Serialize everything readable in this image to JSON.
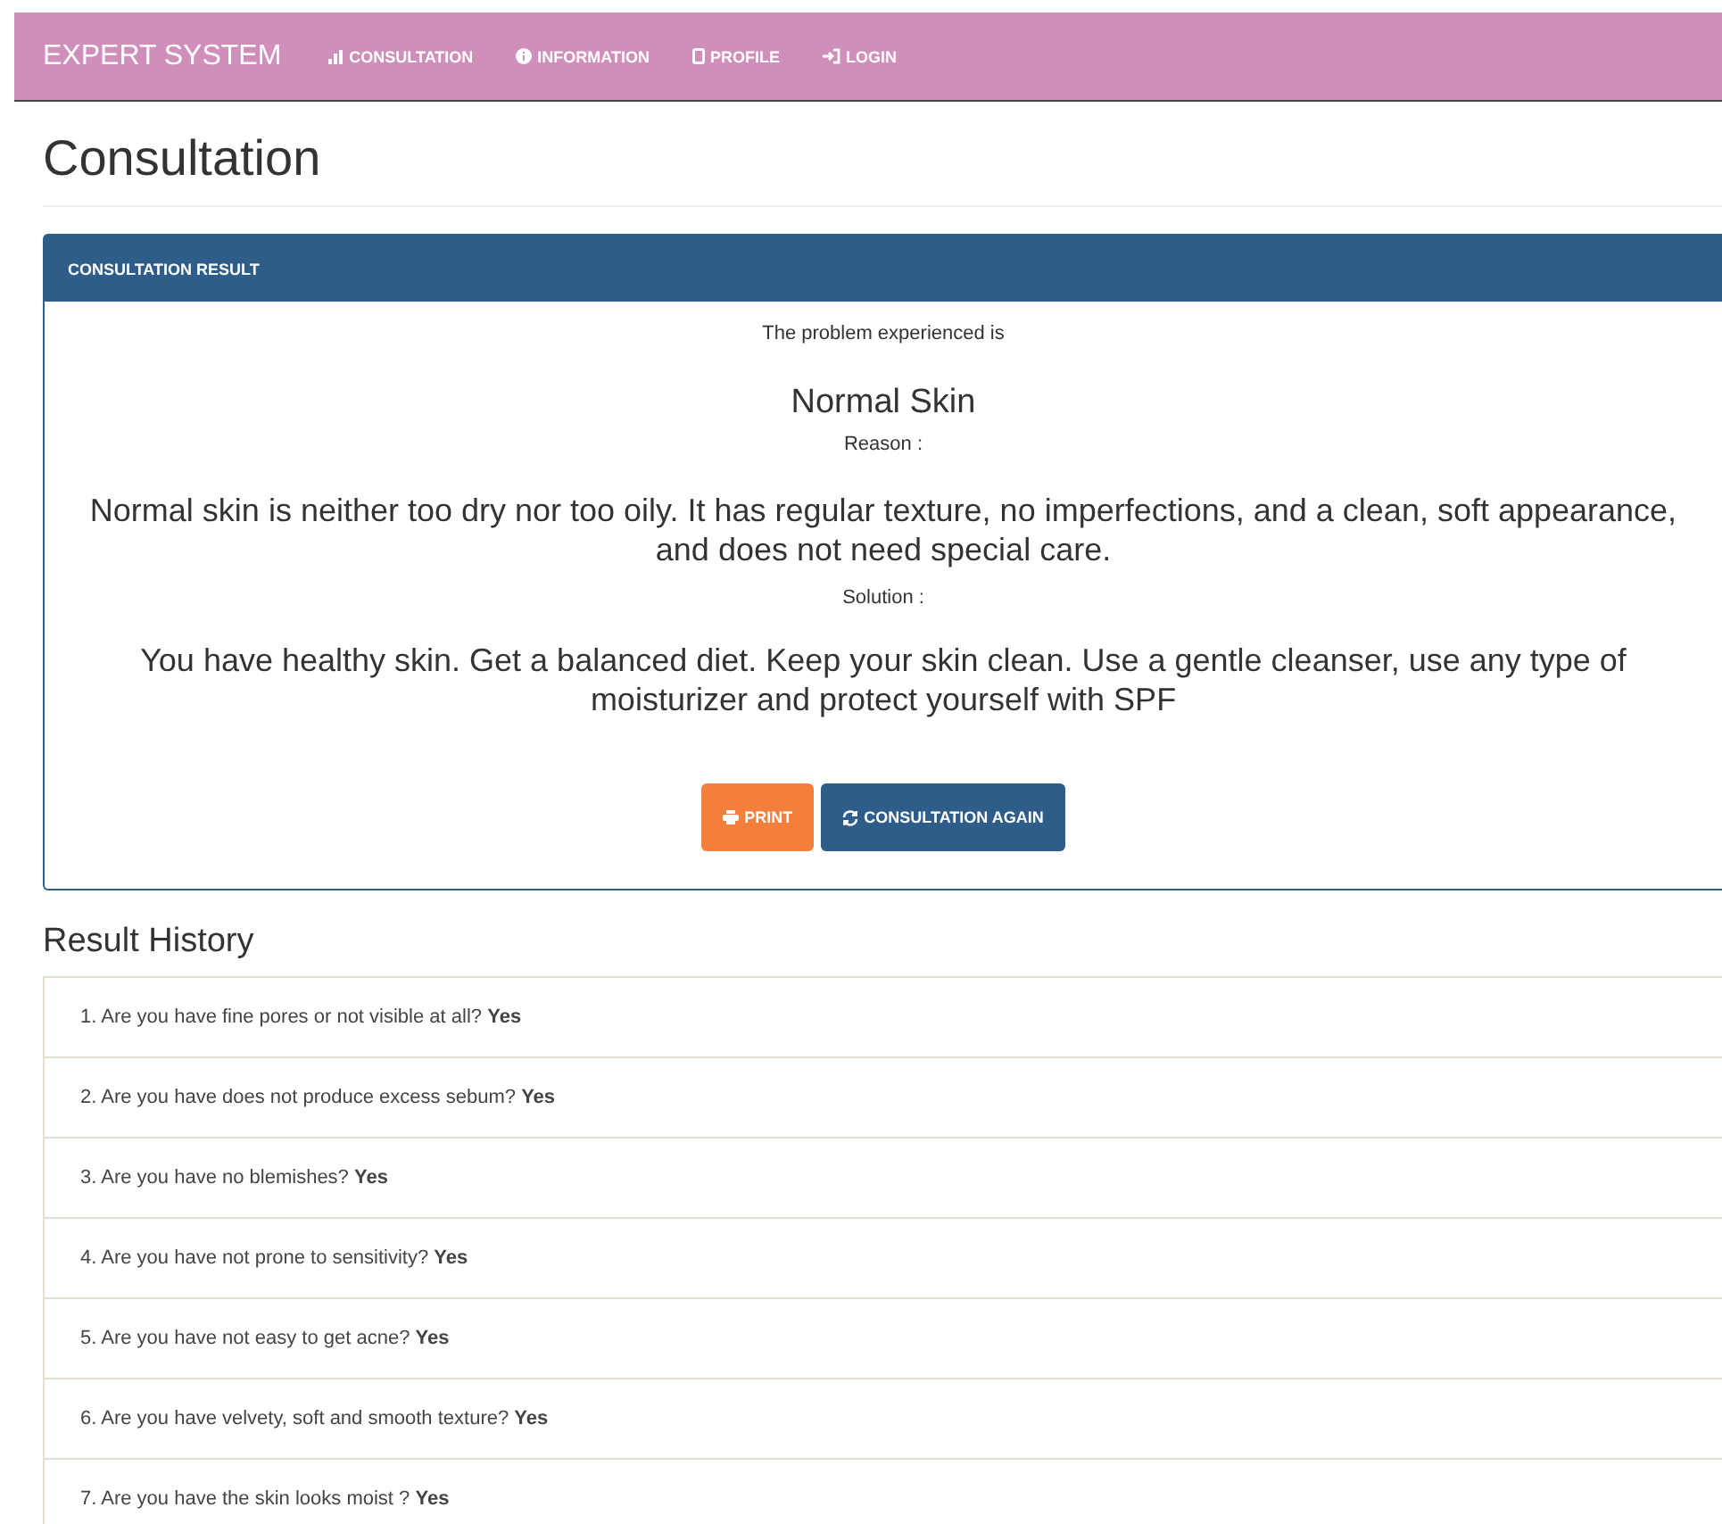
{
  "navbar": {
    "brand": "EXPERT SYSTEM",
    "items": [
      {
        "label": "CONSULTATION",
        "kind": "chart"
      },
      {
        "label": "INFORMATION",
        "kind": "info"
      },
      {
        "label": "PROFILE",
        "kind": "phone"
      },
      {
        "label": "LOGIN",
        "kind": "login"
      }
    ]
  },
  "page_title": "Consultation",
  "result_panel": {
    "title": "CONSULTATION RESULT",
    "intro": "The problem experienced is",
    "diagnosis": "Normal Skin",
    "reason_label": "Reason :",
    "reason": "Normal skin is neither too dry nor too oily. It has regular texture, no imperfections, and a clean, soft appearance, and does not need special care.",
    "solution_label": "Solution :",
    "solution": "You have healthy skin. Get a balanced diet. Keep your skin clean. Use a gentle cleanser, use any type of moisturizer and protect yourself with SPF",
    "buttons": [
      {
        "label": "PRINT",
        "kind": "print"
      },
      {
        "label": "CONSULTATION AGAIN",
        "kind": "again"
      }
    ]
  },
  "history": {
    "title": "Result History",
    "items": [
      {
        "question": "1. Are you have fine pores or not visible at all?",
        "answer": "Yes"
      },
      {
        "question": "2. Are you have does not produce excess sebum?",
        "answer": "Yes"
      },
      {
        "question": "3. Are you have no blemishes?",
        "answer": "Yes"
      },
      {
        "question": "4. Are you have not prone to sensitivity?",
        "answer": "Yes"
      },
      {
        "question": "5. Are you have not easy to get acne?",
        "answer": "Yes"
      },
      {
        "question": "6. Are you have velvety, soft and smooth texture?",
        "answer": "Yes"
      },
      {
        "question": "7. Are you have the skin looks moist ?",
        "answer": "Yes"
      }
    ]
  }
}
